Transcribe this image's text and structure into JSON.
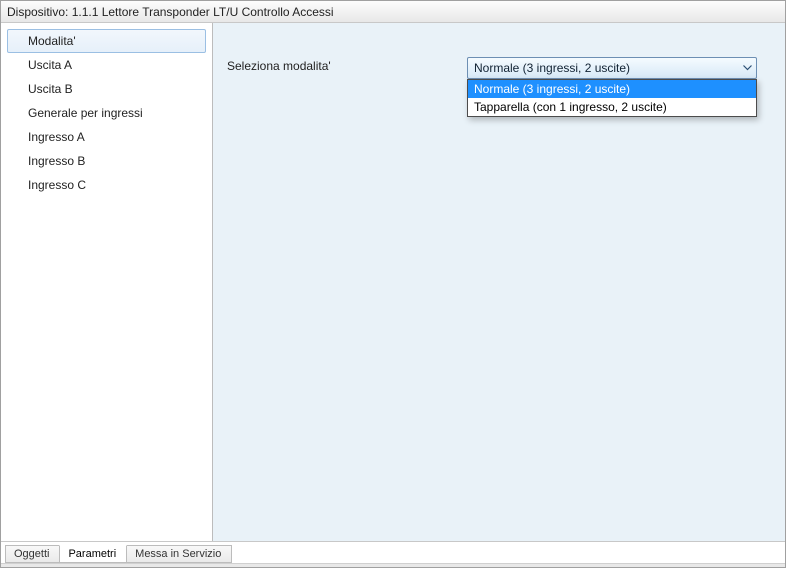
{
  "titlebar": "Dispositivo: 1.1.1 Lettore Transponder LT/U Controllo Accessi",
  "sidebar": {
    "items": [
      {
        "label": "Modalita'",
        "selected": true
      },
      {
        "label": "Uscita A",
        "selected": false
      },
      {
        "label": "Uscita B",
        "selected": false
      },
      {
        "label": "Generale per ingressi",
        "selected": false
      },
      {
        "label": "Ingresso A",
        "selected": false
      },
      {
        "label": "Ingresso B",
        "selected": false
      },
      {
        "label": "Ingresso C",
        "selected": false
      }
    ]
  },
  "form": {
    "label": "Seleziona modalita'",
    "dropdown": {
      "selected": "Normale (3 ingressi, 2 uscite)",
      "expanded": true,
      "options": [
        {
          "label": "Normale (3 ingressi, 2 uscite)",
          "highlighted": true
        },
        {
          "label": "Tapparella (con 1 ingresso, 2 uscite)",
          "highlighted": false
        }
      ]
    }
  },
  "tabs": {
    "items": [
      {
        "label": "Oggetti",
        "active": false
      },
      {
        "label": "Parametri",
        "active": true
      },
      {
        "label": "Messa in Servizio",
        "active": false
      }
    ]
  }
}
